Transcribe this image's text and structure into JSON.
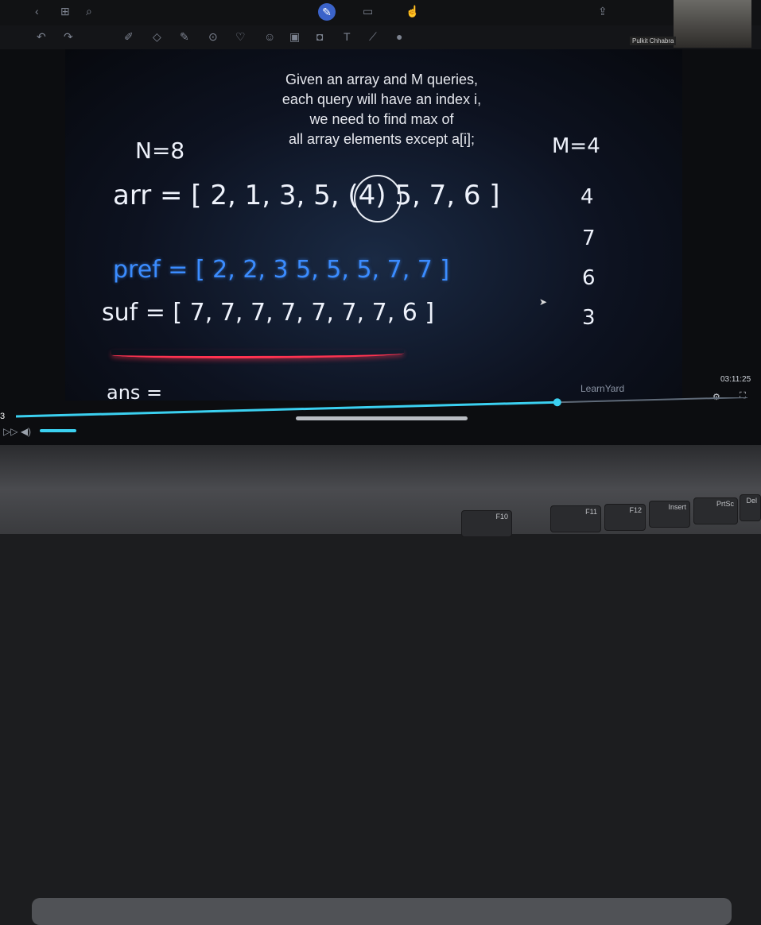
{
  "toolbar": {
    "presenter_name": "Pulkit Chhabra"
  },
  "whiteboard": {
    "prompt_lines": [
      "Given an array and M queries,",
      "each query will have an index i,",
      "we need to find max of",
      "all array elements except a[i];"
    ],
    "n_label": "N=8",
    "m_label": "M=4",
    "arr_label": "arr = [ 2, 1, 3, 5, (4) 5, 7, 6 ]",
    "pref_label": "pref = [ 2, 2, 3  5, 5, 5, 7, 7 ]",
    "suf_label": "suf = [ 7, 7, 7, 7, 7, 7, 7, 6 ]",
    "ans_label": "ans =",
    "queries": [
      "4",
      "7",
      "6",
      "3"
    ]
  },
  "player": {
    "timestamp": "03:11:25",
    "watermark": "LearnYard",
    "progress_fraction": 0.74,
    "counter": "3"
  },
  "keyboard": {
    "keys": [
      "F10",
      "F11",
      "F12",
      "Insert",
      "PrtSc",
      "Del"
    ]
  },
  "colors": {
    "pref_ink": "#3b8cff",
    "suf_ink": "#eef2fb",
    "underline": "#ff3350",
    "progress": "#3bd0f0"
  }
}
